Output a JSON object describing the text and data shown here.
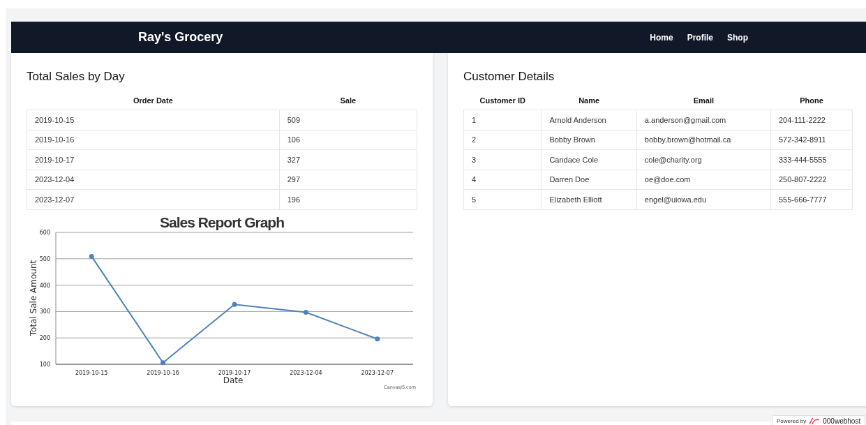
{
  "navbar": {
    "brand": "Ray's Grocery",
    "links": [
      {
        "label": "Home"
      },
      {
        "label": "Profile"
      },
      {
        "label": "Shop"
      }
    ]
  },
  "sales_card": {
    "title": "Total Sales by Day",
    "table": {
      "columns": [
        "Order Date",
        "Sale"
      ],
      "rows": [
        [
          "2019-10-15",
          "509"
        ],
        [
          "2019-10-16",
          "106"
        ],
        [
          "2019-10-17",
          "327"
        ],
        [
          "2023-12-04",
          "297"
        ],
        [
          "2023-12-07",
          "196"
        ]
      ]
    },
    "chart_data": {
      "type": "line",
      "title": "Sales Report Graph",
      "xlabel": "Date",
      "ylabel": "Total Sale Amount",
      "categories": [
        "2019-10-15",
        "2019-10-16",
        "2019-10-17",
        "2023-12-04",
        "2023-12-07"
      ],
      "series": [
        {
          "color": "#4f81bc",
          "marker": true,
          "values": [
            509,
            106,
            327,
            297,
            196
          ]
        }
      ],
      "grid": true,
      "ylim": [
        100,
        600
      ],
      "yticks": [
        100,
        200,
        300,
        400,
        500,
        600
      ]
    },
    "chart_credit": "CanvasJS.com"
  },
  "customer_card": {
    "title": "Customer Details",
    "table": {
      "columns": [
        "Customer ID",
        "Name",
        "Email",
        "Phone"
      ],
      "rows": [
        [
          "1",
          "Arnold Anderson",
          "a.anderson@gmail.com",
          "204-111-2222"
        ],
        [
          "2",
          "Bobby Brown",
          "bobby.brown@hotmail.ca",
          "572-342-8911"
        ],
        [
          "3",
          "Candace Cole",
          "cole@charity.org",
          "333-444-5555"
        ],
        [
          "4",
          "Darren Doe",
          "oe@doe.com",
          "250-807-2222"
        ],
        [
          "5",
          "Elizabeth Elliott",
          "engel@uiowa.edu",
          "555-666-7777"
        ]
      ]
    }
  },
  "hosting_badge": {
    "prefix": "Powered by",
    "name": "000webhost"
  }
}
